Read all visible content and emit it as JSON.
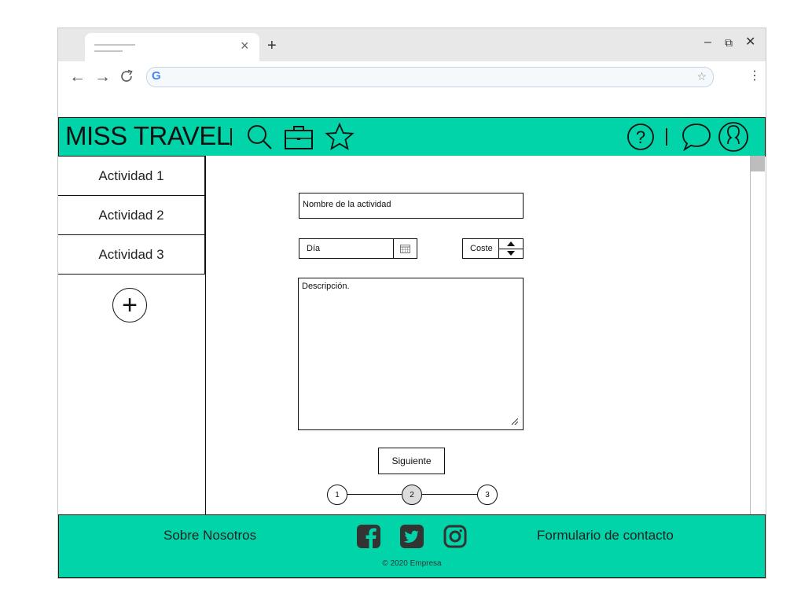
{
  "browser": {
    "new_tab_symbol": "+",
    "close_tab_symbol": "×",
    "back_symbol": "←",
    "forward_symbol": "→",
    "reload_symbol": "C",
    "google_letter": "G",
    "bookmark_symbol": "☆",
    "menu_symbol": "⋮",
    "minimize_symbol": "–",
    "restore_symbol": "⧉",
    "close_symbol": "✕"
  },
  "header": {
    "logo": "MISS TRAVEL",
    "help_symbol": "?"
  },
  "sidebar": {
    "items": [
      {
        "label": "Actividad 1"
      },
      {
        "label": "Actividad 2"
      },
      {
        "label": "Actividad 3"
      }
    ],
    "add_symbol": "+"
  },
  "form": {
    "name_field": "Nombre de la actividad",
    "day_field": "Día",
    "cost_field": "Coste",
    "description_field": "Descripción.",
    "next_button": "Siguiente",
    "steps": [
      {
        "label": "1",
        "active": false
      },
      {
        "label": "2",
        "active": true
      },
      {
        "label": "3",
        "active": false
      }
    ]
  },
  "footer": {
    "about_link": "Sobre Nosotros",
    "contact_link": "Formulario de contacto",
    "copyright": "© 2020 Empresa"
  },
  "colors": {
    "accent": "#00d4a8",
    "step_active": "#dcdcdc"
  }
}
